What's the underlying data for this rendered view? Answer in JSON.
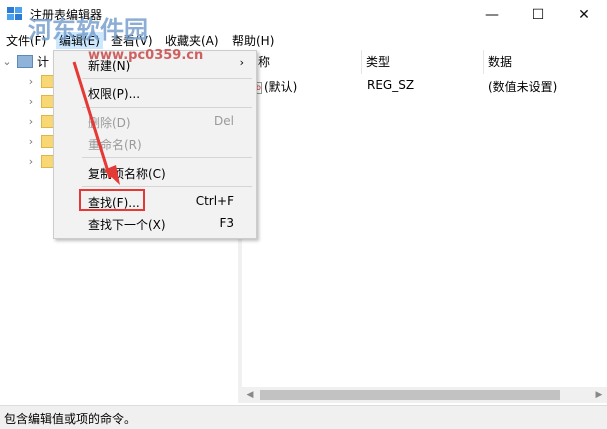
{
  "window": {
    "title": "注册表编辑器"
  },
  "menubar": {
    "file": "文件(F)",
    "edit": "编辑(E)",
    "view": "查看(V)",
    "favorites": "收藏夹(A)",
    "help": "帮助(H)"
  },
  "tree": {
    "root_label": "计"
  },
  "list": {
    "columns": [
      "名称",
      "类型",
      "数据"
    ],
    "rows": [
      {
        "name": "(默认)",
        "type": "REG_SZ",
        "data": "(数值未设置)"
      }
    ]
  },
  "context_menu": {
    "new": "新建(N)",
    "permissions": "权限(P)...",
    "delete": "删除(D)",
    "delete_shortcut": "Del",
    "rename": "重命名(R)",
    "copy_key_name": "复制项名称(C)",
    "find": "查找(F)...",
    "find_shortcut": "Ctrl+F",
    "find_next": "查找下一个(X)",
    "find_next_shortcut": "F3"
  },
  "status": {
    "text": "包含编辑值或项的命令。"
  },
  "watermark": {
    "line1": "河东软件园",
    "line2": "www.pc0359.cn"
  },
  "colors": {
    "highlight": "#e53935",
    "menu_active": "#cce8ff",
    "folder": "#f8d775"
  },
  "icons": [
    "regedit-icon",
    "minimize-icon",
    "maximize-icon",
    "close-icon",
    "folder-icon",
    "chevron-right-icon",
    "submenu-arrow-icon",
    "red-arrow-annotation"
  ]
}
